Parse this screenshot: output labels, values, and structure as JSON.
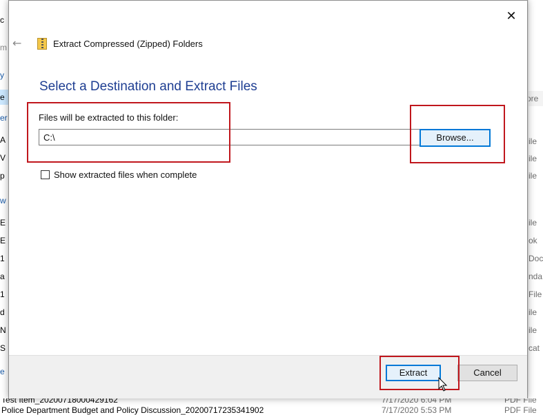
{
  "background": {
    "left_fragments": [
      "c",
      "m",
      "y",
      "e",
      "er",
      "A",
      "V",
      "p",
      "w",
      "E",
      "E",
      "1",
      "a",
      "1",
      "d",
      "N",
      "S",
      "e"
    ],
    "right_fragments": [
      "ore",
      "ile",
      "ile",
      "ile",
      "ile",
      "ok",
      "Doc",
      "nda",
      "File",
      "ile",
      "ile",
      "cat"
    ],
    "files": [
      {
        "name": "Test Item_20200718000429162",
        "date": "7/17/2020 6:04 PM",
        "type": "PDF File"
      },
      {
        "name": "Police Department Budget and Policy Discussion_20200717235341902",
        "date": "7/17/2020 5:53 PM",
        "type": "PDF File"
      }
    ]
  },
  "dialog": {
    "close_glyph": "✕",
    "back_glyph": "←",
    "title": "Extract Compressed (Zipped) Folders",
    "heading": "Select a Destination and Extract Files",
    "folder_label": "Files will be extracted to this folder:",
    "path_value": "C:\\",
    "browse_label": "Browse...",
    "checkbox_label": "Show extracted files when complete",
    "checkbox_checked": false,
    "extract_label": "Extract",
    "cancel_label": "Cancel"
  },
  "colors": {
    "heading": "#1e3e92",
    "highlight": "#c0161c",
    "accent": "#0078d7"
  }
}
